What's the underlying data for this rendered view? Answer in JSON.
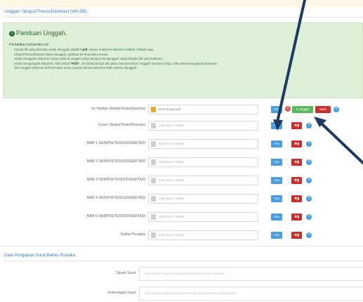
{
  "page": {
    "title": "Unggah Skripsi/Thesis/Disertasi (WAJIB)"
  },
  "guide": {
    "heading": "Panduan Unggah.",
    "intro": "Perhatikan hal berikut ini!",
    "items": [
      {
        "before": "Format file yang diizinkan untuk diunggah adalah ",
        "strong": "*.pdf",
        "after": ", ukuran maksimal dokumen adalah 2 MByte saja."
      },
      {
        "before": "Skripsi/Thesis/Disertasi akan diunggah, pastikan ke Repository ",
        "strong": "",
        "after": "sesuai."
      },
      {
        "before": "Untuk mengganti dokumen yang sudah di unggah cukup dengan mengunggah ulang dengan file yang berbeda.",
        "strong": "",
        "after": ""
      },
      {
        "before": "Untuk mengunggah dokumen, klik tombol ",
        "strong": "\"Pilih\"",
        "after": ", cari dokumennya lalu akan muncul tombol \"Unggah\" berwarna hijau. Klik untuk mengupload dokumen."
      },
      {
        "before": "Jika Unggah dokumen berhasil akan muncul pesan bahwa dokumen telah sukses diunggah.",
        "strong": "",
        "after": ""
      }
    ]
  },
  "uploads": {
    "first_row": {
      "label": "Isi Tambin Skripsi/Tesis/Disertasi",
      "file_name": "BAB Skripsi.pdf",
      "browse": "Pilih",
      "upload_label": "Unggah",
      "cancel_label": "Batal"
    },
    "rows": [
      {
        "label": "Cover Skripsi/Tesis/Disertasi",
        "placeholder": "(pdf) Max 2 MByte",
        "browse": "Pilih"
      },
      {
        "label": "BAB 1 SKRIPSI/TESIS/DISERTASI",
        "placeholder": "(pdf) Max 2 MByte",
        "browse": "Pilih"
      },
      {
        "label": "BAB 2 SKRIPSI/TESIS/DISERTASI",
        "placeholder": "(pdf) Max 2 MByte",
        "browse": "Pilih"
      },
      {
        "label": "BAB 3 SKRIPSI/TESIS/DISERTASI",
        "placeholder": "(pdf) Max 2 MByte",
        "browse": "Pilih"
      },
      {
        "label": "BAB 4 SKRIPSI/TESIS/DISERTASI",
        "placeholder": "(pdf) Max 2 MByte",
        "browse": "Pilih"
      },
      {
        "label": "BAB 5 SKRIPSI/TESIS/DISERTASI",
        "placeholder": "(pdf) Max 2 MByte",
        "browse": "Pilih"
      },
      {
        "label": "Daftar Pustaka",
        "placeholder": "(pdf) Max 2 MByte",
        "browse": "Pilih"
      }
    ]
  },
  "free_letter": {
    "title": "Data Pengajuan Surat Bebas Pustaka",
    "fields": [
      {
        "label": "Tujuan Surat",
        "placeholder": "Tulis Instansi Tujuan Surat Bebas Pustaka ini akan diberikan"
      },
      {
        "label": "Keterangan Surat",
        "placeholder": "Tulis secara singkat untuk apa Surat Bebas Pustaka ini dipergunakan"
      }
    ]
  },
  "colors": {
    "accent_blue": "#4a9ede",
    "danger_red": "#c9302c",
    "success_green": "#5cb85c",
    "annotation_arrow": "#1d3b63"
  }
}
